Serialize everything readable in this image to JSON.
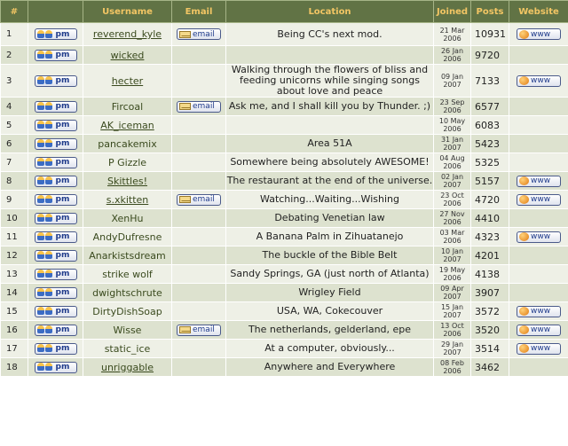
{
  "columns": {
    "num": "#",
    "username": "Username",
    "email": "Email",
    "location": "Location",
    "joined": "Joined",
    "posts": "Posts",
    "website": "Website"
  },
  "buttons": {
    "pm": "pm",
    "email": "email",
    "www": "www"
  },
  "rows": [
    {
      "num": "1",
      "username": "reverend_kyle",
      "linked": true,
      "email": true,
      "location": "Being CC's next mod.",
      "joined": "21 Mar 2006",
      "posts": "10931",
      "www": true
    },
    {
      "num": "2",
      "username": "wicked",
      "linked": true,
      "email": false,
      "location": "",
      "joined": "26 Jan 2006",
      "posts": "9720",
      "www": false
    },
    {
      "num": "3",
      "username": "hecter",
      "linked": true,
      "email": false,
      "location": "Walking through the flowers of bliss and feeding unicorns while singing songs about love and peace",
      "joined": "09 Jan 2007",
      "posts": "7133",
      "www": true
    },
    {
      "num": "4",
      "username": "Fircoal",
      "linked": false,
      "email": true,
      "location": "Ask me, and I shall kill you by Thunder. ;)",
      "joined": "23 Sep 2006",
      "posts": "6577",
      "www": false
    },
    {
      "num": "5",
      "username": "AK_iceman",
      "linked": true,
      "email": false,
      "location": "",
      "joined": "10 May 2006",
      "posts": "6083",
      "www": false
    },
    {
      "num": "6",
      "username": "pancakemix",
      "linked": false,
      "email": false,
      "location": "Area 51A",
      "joined": "31 Jan 2007",
      "posts": "5423",
      "www": false
    },
    {
      "num": "7",
      "username": "P Gizzle",
      "linked": false,
      "email": false,
      "location": "Somewhere being absolutely AWESOME!",
      "joined": "04 Aug 2006",
      "posts": "5325",
      "www": false
    },
    {
      "num": "8",
      "username": "Skittles!",
      "linked": true,
      "email": false,
      "location": "The restaurant at the end of the universe.",
      "joined": "02 Jan 2007",
      "posts": "5157",
      "www": true
    },
    {
      "num": "9",
      "username": "s.xkitten",
      "linked": true,
      "email": true,
      "location": "Watching...Waiting...Wishing",
      "joined": "23 Oct 2006",
      "posts": "4720",
      "www": true
    },
    {
      "num": "10",
      "username": "XenHu",
      "linked": false,
      "email": false,
      "location": "Debating Venetian law",
      "joined": "27 Nov 2006",
      "posts": "4410",
      "www": false
    },
    {
      "num": "11",
      "username": "AndyDufresne",
      "linked": false,
      "email": false,
      "location": "A Banana Palm in Zihuatanejo",
      "joined": "03 Mar 2006",
      "posts": "4323",
      "www": true
    },
    {
      "num": "12",
      "username": "Anarkistsdream",
      "linked": false,
      "email": false,
      "location": "The buckle of the Bible Belt",
      "joined": "10 Jan 2007",
      "posts": "4201",
      "www": false
    },
    {
      "num": "13",
      "username": "strike wolf",
      "linked": false,
      "email": false,
      "location": "Sandy Springs, GA (just north of Atlanta)",
      "joined": "19 May 2006",
      "posts": "4138",
      "www": false
    },
    {
      "num": "14",
      "username": "dwightschrute",
      "linked": false,
      "email": false,
      "location": "Wrigley Field",
      "joined": "09 Apr 2007",
      "posts": "3907",
      "www": false
    },
    {
      "num": "15",
      "username": "DirtyDishSoap",
      "linked": false,
      "email": false,
      "location": "USA, WA, Cokecouver",
      "joined": "15 Jan 2007",
      "posts": "3572",
      "www": true
    },
    {
      "num": "16",
      "username": "Wisse",
      "linked": false,
      "email": true,
      "location": "The netherlands, gelderland, epe",
      "joined": "13 Oct 2006",
      "posts": "3520",
      "www": true
    },
    {
      "num": "17",
      "username": "static_ice",
      "linked": false,
      "email": false,
      "location": "At a computer, obviously...",
      "joined": "29 Jan 2007",
      "posts": "3514",
      "www": true
    },
    {
      "num": "18",
      "username": "unriggable",
      "linked": true,
      "email": false,
      "location": "Anywhere and Everywhere",
      "joined": "08 Feb 2006",
      "posts": "3462",
      "www": false
    }
  ]
}
